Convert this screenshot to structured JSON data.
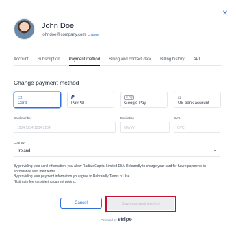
{
  "dialog": {
    "close_icon": "close-icon"
  },
  "profile": {
    "name": "John Doe",
    "email": "johndoe@company.com",
    "change_label": "change"
  },
  "tabs": [
    {
      "label": "Account"
    },
    {
      "label": "Subscription"
    },
    {
      "label": "Payment method",
      "active": true
    },
    {
      "label": "Billing and contact data"
    },
    {
      "label": "Billing history"
    },
    {
      "label": "API"
    }
  ],
  "section_title": "Change payment method",
  "methods": [
    {
      "label": "Card",
      "icon": "credit-card-icon",
      "selected": true
    },
    {
      "label": "PayPal",
      "icon": "paypal-icon"
    },
    {
      "label": "Google Pay",
      "icon": "google-pay-icon",
      "icon_text": "G Pay"
    },
    {
      "label": "US bank account",
      "icon": "bank-icon"
    }
  ],
  "fields": {
    "card_number": {
      "label": "Card number",
      "placeholder": "1234 1234 1234 1234"
    },
    "expiration": {
      "label": "Expiration",
      "placeholder": "MM/YY"
    },
    "cvc": {
      "label": "CVC",
      "placeholder": "CVC"
    },
    "country": {
      "label": "Country",
      "value": "Ireland"
    }
  },
  "legal": {
    "line1": "By providing your card information, you allow RadiateCapital Limited DBA Rebrandly to charge your card for future payments in accordance with their terms.",
    "line2": "By providing your payment information you agree to Rebrandly Terms of Use.",
    "line3": "*Estimate fee considering current pricing."
  },
  "buttons": {
    "cancel": "Cancel",
    "save": "Save payment method"
  },
  "footer": {
    "powered_by": "Powered by",
    "brand": "stripe"
  },
  "colors": {
    "accent": "#2f6fd6",
    "highlight": "#c8102e"
  }
}
